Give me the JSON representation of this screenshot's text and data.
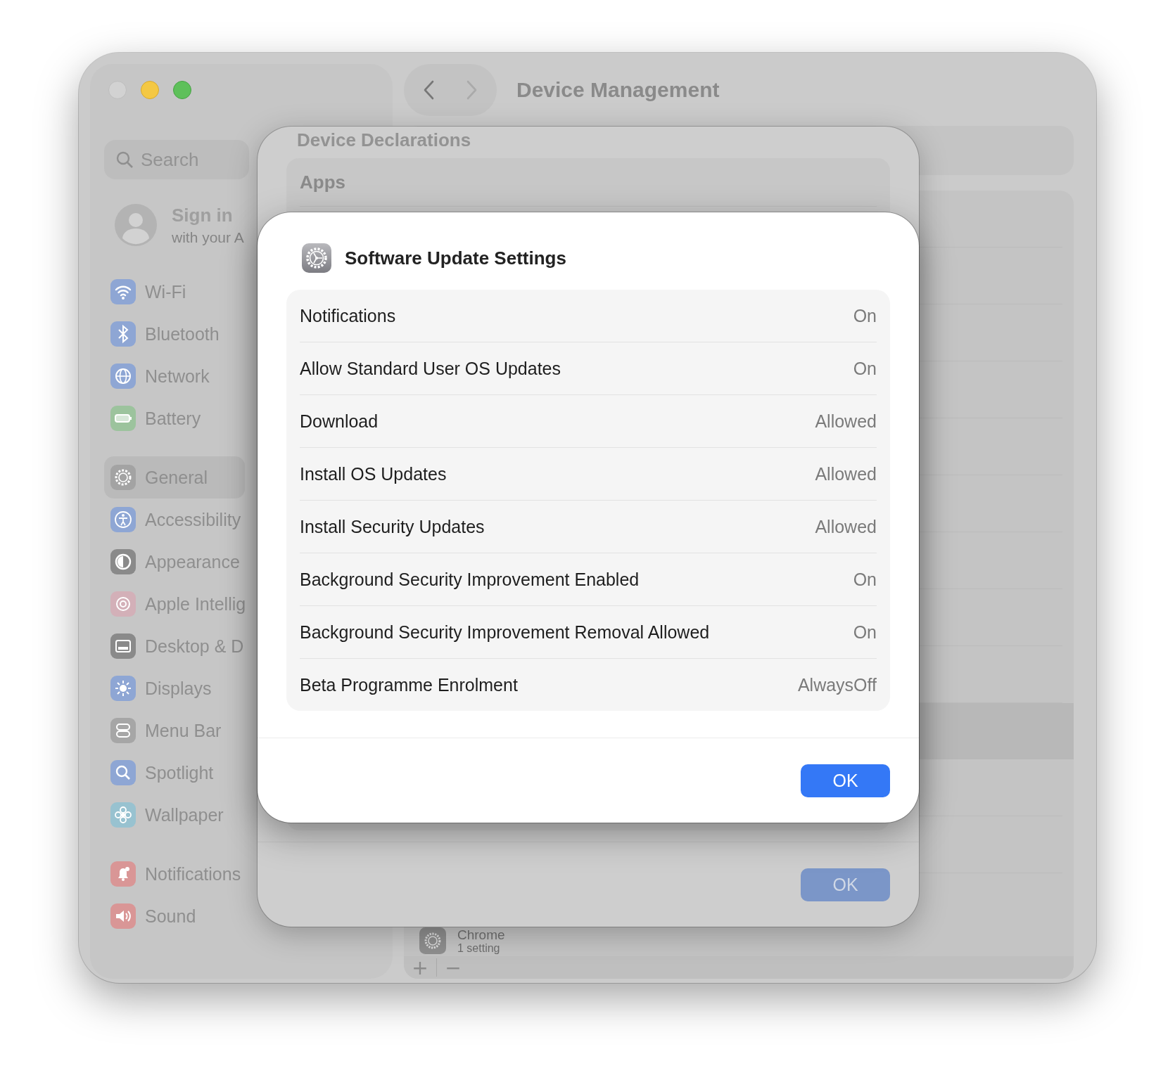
{
  "window": {
    "title": "Device Management"
  },
  "traffic_lights": [
    {
      "kind": "close",
      "disabled": true
    },
    {
      "kind": "minimize",
      "disabled": false
    },
    {
      "kind": "zoom",
      "disabled": false
    }
  ],
  "navigation": [
    {
      "kind": "back",
      "disabled": false
    },
    {
      "kind": "forward",
      "disabled": true
    }
  ],
  "sidebar": {
    "search": {
      "placeholder": "Search"
    },
    "account": {
      "title": "Sign in",
      "subtitle": "with your A"
    },
    "groups": [
      [
        {
          "label": "Wi-Fi",
          "kind": "wifi",
          "selected": false
        },
        {
          "label": "Bluetooth",
          "kind": "bluetooth",
          "selected": false
        },
        {
          "label": "Network",
          "kind": "network",
          "selected": false
        },
        {
          "label": "Battery",
          "kind": "battery",
          "selected": false
        }
      ],
      [
        {
          "label": "General",
          "kind": "general",
          "selected": true
        },
        {
          "label": "Accessibility",
          "kind": "accessibility",
          "selected": false
        },
        {
          "label": "Appearance",
          "kind": "appearance",
          "selected": false
        },
        {
          "label": "Apple Intellig",
          "kind": "intelligence",
          "selected": false
        },
        {
          "label": "Desktop & D",
          "kind": "desktop",
          "selected": false
        },
        {
          "label": "Displays",
          "kind": "displays",
          "selected": false
        },
        {
          "label": "Menu Bar",
          "kind": "menubar",
          "selected": false
        },
        {
          "label": "Spotlight",
          "kind": "spotlight",
          "selected": false
        },
        {
          "label": "Wallpaper",
          "kind": "wallpaper",
          "selected": false
        }
      ],
      [
        {
          "label": "Notifications",
          "kind": "notifications",
          "selected": false
        },
        {
          "label": "Sound",
          "kind": "sound",
          "selected": false
        }
      ]
    ]
  },
  "content": {
    "item": {
      "title": "Chrome",
      "subtitle": "1 setting"
    },
    "toolbar": [
      "+",
      "−"
    ]
  },
  "back_sheet": {
    "section_title": "Device Declarations",
    "rows": [
      {
        "label": "Apps"
      }
    ],
    "button": "OK"
  },
  "dialog": {
    "title": "Software Update Settings",
    "rows": [
      {
        "label": "Notifications",
        "value": "On"
      },
      {
        "label": "Allow Standard User OS Updates",
        "value": "On"
      },
      {
        "label": "Download",
        "value": "Allowed"
      },
      {
        "label": "Install OS Updates",
        "value": "Allowed"
      },
      {
        "label": "Install Security Updates",
        "value": "Allowed"
      },
      {
        "label": "Background Security Improvement Enabled",
        "value": "On"
      },
      {
        "label": "Background Security Improvement Removal Allowed",
        "value": "On"
      },
      {
        "label": "Beta Programme Enrolment",
        "value": "AlwaysOff"
      }
    ],
    "button": "OK"
  }
}
